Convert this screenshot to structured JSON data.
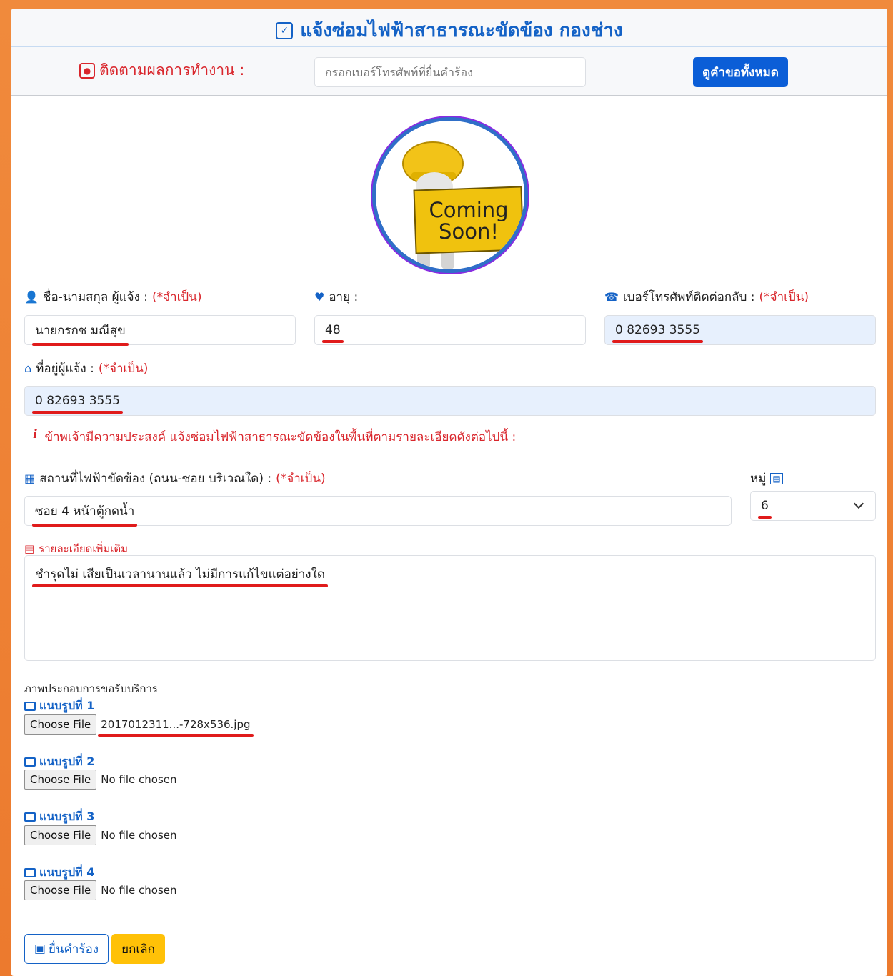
{
  "header": {
    "title": "แจ้งซ่อมไฟฟ้าสาธารณะขัดข้อง กองช่าง",
    "track_label": "ติดตามผลการทำงาน :",
    "track_placeholder": "กรอกเบอร์โทรศัพท์ที่ยื่นคำร้อง",
    "view_all_button": "ดูคำขอทั้งหมด"
  },
  "logo": {
    "text_line1": "Coming",
    "text_line2": "Soon!"
  },
  "form": {
    "name_label": "ชื่อ-นามสกุล ผู้แจ้ง :",
    "required": "(*จำเป็น)",
    "name_value": "นายกรกช  มณีสุข",
    "age_label": "อายุ :",
    "age_value": "48",
    "phone_label": "เบอร์โทรศัพท์ติดต่อกลับ :",
    "phone_value": "0 82693 3555",
    "address_label": "ที่อยู่ผู้แจ้ง :",
    "address_value": "0 82693 3555",
    "notice_icon": "i",
    "notice": "ข้าพเจ้ามีความประสงค์ แจ้งซ่อมไฟฟ้าสาธารณะขัดข้องในพื้นที่ตามรายละเอียดดังต่อไปนี้ :",
    "location_label": "สถานที่ไฟฟ้าขัดข้อง (ถนน-ซอย บริเวณใด) :",
    "location_value": "ซอย 4 หน้าตู้กดน้ำ",
    "moo_label": "หมู่",
    "moo_value": "6",
    "details_label": "รายละเอียดเพิ่มเติม",
    "details_value": "ชำรุดไม่ เสียเป็นเวลานานแล้ว ไม่มีการแก้ไขแต่อย่างใด"
  },
  "attachments": {
    "heading": "ภาพประกอบการขอรับบริการ",
    "choose_label": "Choose File",
    "items": [
      {
        "label": "แนบรูปที่ 1",
        "file": "2017012311...-728x536.jpg"
      },
      {
        "label": "แนบรูปที่ 2",
        "file": "No file chosen"
      },
      {
        "label": "แนบรูปที่ 3",
        "file": "No file chosen"
      },
      {
        "label": "แนบรูปที่ 4",
        "file": "No file chosen"
      }
    ]
  },
  "actions": {
    "submit": "ยื่นคำร้อง",
    "cancel": "ยกเลิก"
  },
  "colors": {
    "primary": "#0b5ed7",
    "required": "#d9262c",
    "warning": "#ffc107",
    "background": "#ec7a2e"
  }
}
